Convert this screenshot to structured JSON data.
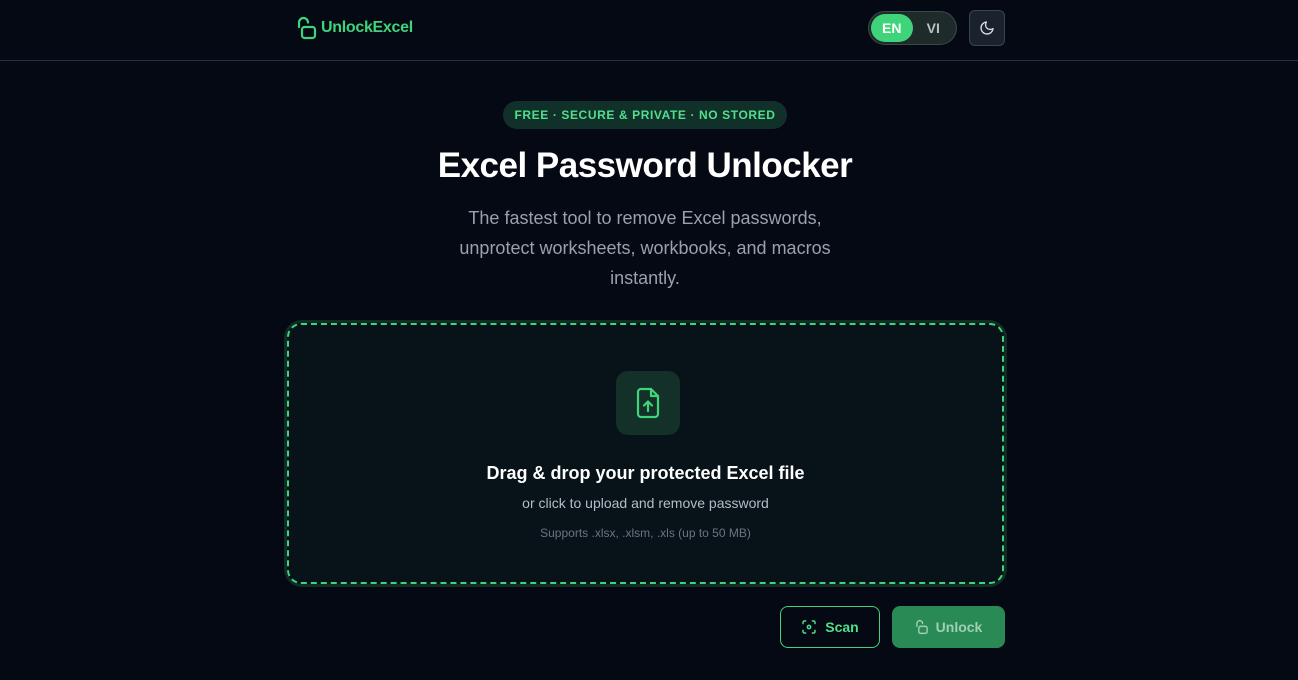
{
  "header": {
    "logo_text": "UnlockExcel",
    "languages": [
      {
        "label": "EN",
        "active": true
      },
      {
        "label": "VI",
        "active": false
      }
    ],
    "theme_icon": "moon-icon"
  },
  "hero": {
    "badge": "FREE · SECURE & PRIVATE · NO STORED",
    "title": "Excel Password Unlocker",
    "subtitle": "The fastest tool to remove Excel passwords, unprotect worksheets, workbooks, and macros instantly."
  },
  "dropzone": {
    "icon": "file-upload-icon",
    "title": "Drag & drop your protected Excel file",
    "subtitle": "or click to upload and remove password",
    "support": "Supports .xlsx, .xlsm, .xls (up to 50 MB)"
  },
  "actions": {
    "scan_label": "Scan",
    "scan_icon": "scan-icon",
    "unlock_label": "Unlock",
    "unlock_icon": "unlock-icon"
  },
  "colors": {
    "accent": "#3fd37a",
    "background": "#050914",
    "unlock_button": "#2a8a55"
  }
}
